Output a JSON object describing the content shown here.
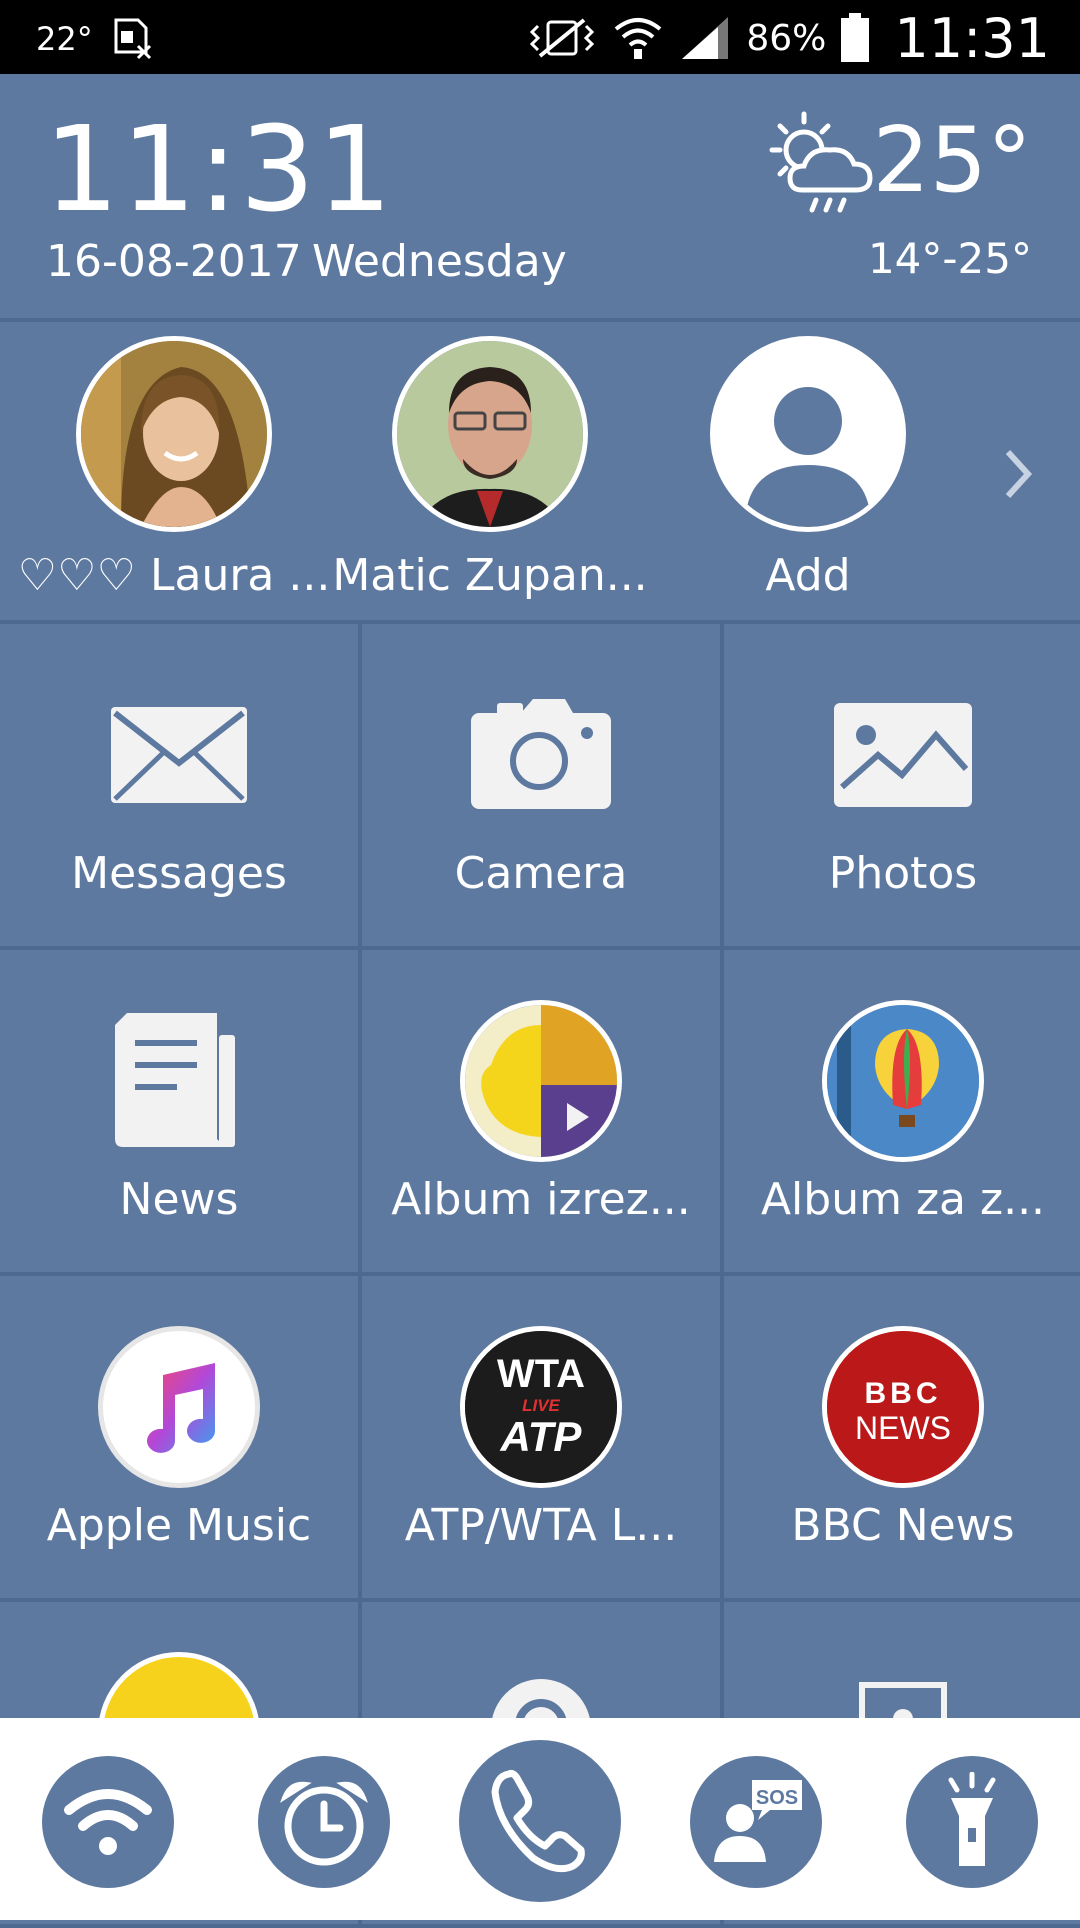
{
  "status_bar": {
    "temperature": "22°",
    "battery_percent": "86%",
    "time": "11:31",
    "icons": [
      "sim-warning-icon",
      "vibrate-icon",
      "wifi-icon",
      "signal-icon",
      "battery-icon"
    ]
  },
  "header": {
    "clock": "11:31",
    "date": "16-08-2017",
    "day": "Wednesday",
    "weather_icon": "partly-cloudy-rain-icon",
    "temperature": "25°",
    "temperature_range": "14°-25°"
  },
  "contacts": {
    "items": [
      {
        "name": "♡♡♡ Laura ..."
      },
      {
        "name": "Matic Zupan..."
      },
      {
        "name": "Add"
      }
    ],
    "more_icon": "chevron-right-icon"
  },
  "apps": [
    {
      "label": "Messages",
      "icon": "envelope-icon"
    },
    {
      "label": "Camera",
      "icon": "camera-icon"
    },
    {
      "label": "Photos",
      "icon": "picture-icon"
    },
    {
      "label": "News",
      "icon": "newspaper-icon"
    },
    {
      "label": "Album izrez...",
      "icon": "album-cutout-icon"
    },
    {
      "label": "Album za z...",
      "icon": "balloon-album-icon"
    },
    {
      "label": "Apple Music",
      "icon": "music-note-icon"
    },
    {
      "label": "ATP/WTA L...",
      "icon": "wta-atp-live-icon"
    },
    {
      "label": "BBC News",
      "icon": "bbc-news-icon"
    }
  ],
  "app_logos": {
    "wta": "WTA",
    "live": "LIVE",
    "atp": "ATP",
    "bbc_top": "BBC",
    "bbc_bottom": "NEWS"
  },
  "bottom_bar": {
    "buttons": [
      {
        "icon": "wifi-icon"
      },
      {
        "icon": "alarm-clock-icon"
      },
      {
        "icon": "phone-icon"
      },
      {
        "icon": "sos-icon",
        "text": "SOS"
      },
      {
        "icon": "flashlight-icon"
      }
    ]
  },
  "colors": {
    "background": "#5e79a0",
    "divider": "#4e6990",
    "status_bar": "#000000",
    "bottom_bar": "#ffffff"
  }
}
